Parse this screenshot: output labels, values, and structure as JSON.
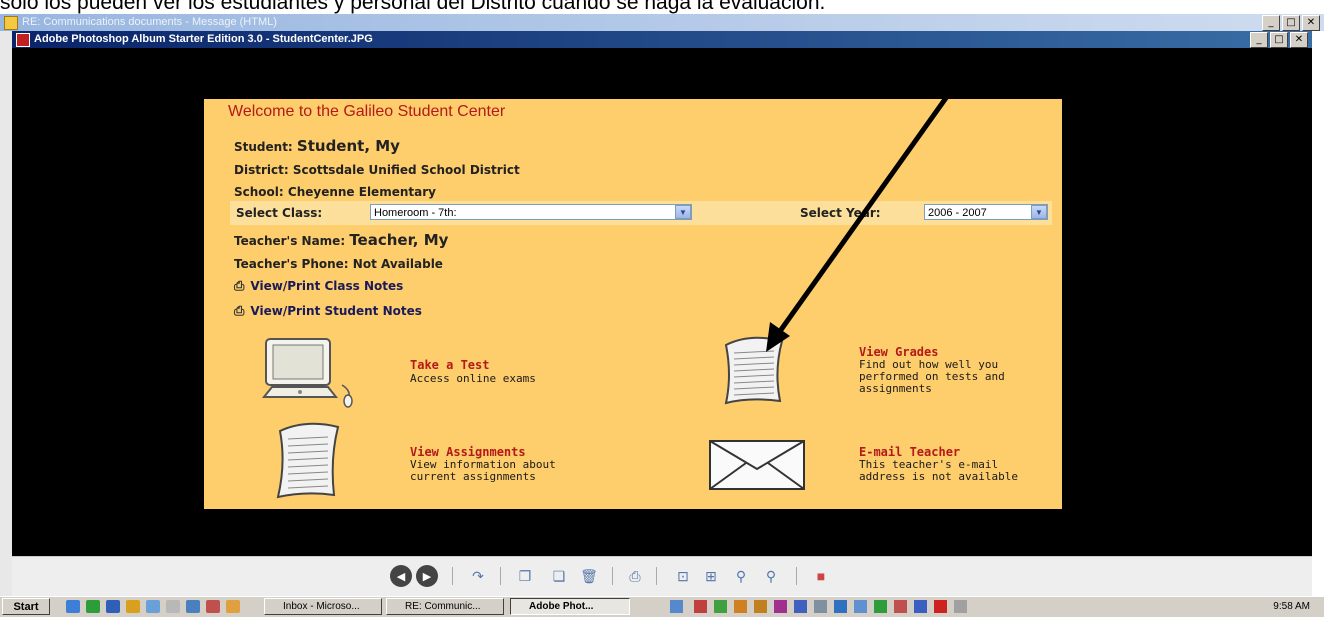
{
  "caption": "solo los pueden ver los estudiantes y personal del Distrito cuando se haga la evaluacion.",
  "outer_window": {
    "title": "RE: Communications documents - Message (HTML)"
  },
  "app_window": {
    "title": "Adobe Photoshop Album Starter Edition 3.0 - StudentCenter.JPG"
  },
  "window_buttons": {
    "minimize": "_",
    "maximize": "□",
    "close": "✕"
  },
  "student_center": {
    "welcome": "Welcome to the Galileo Student Center",
    "student_label": "Student:",
    "student_name": "Student, My",
    "district_label": "District:",
    "district_value": "Scottsdale Unified School District",
    "school_label": "School:",
    "school_value": "Cheyenne Elementary",
    "select_class_label": "Select Class:",
    "select_class_value": "Homeroom - 7th:",
    "select_year_label": "Select Year:",
    "select_year_value": "2006 - 2007",
    "teacher_label": "Teacher's Name:",
    "teacher_name": "Teacher, My",
    "phone_label": "Teacher's Phone:",
    "phone_value": "Not Available",
    "class_notes_link": "View/Print Class Notes",
    "student_notes_link": "View/Print Student Notes",
    "tiles": {
      "take_test": {
        "title": "Take a Test",
        "desc": "Access online exams"
      },
      "view_grades": {
        "title": "View Grades",
        "desc1": "Find out how well you",
        "desc2": "performed on tests and",
        "desc3": "assignments"
      },
      "view_assignments": {
        "title": "View Assignments",
        "desc1": "View information about",
        "desc2": "current assignments"
      },
      "email_teacher": {
        "title": "E-mail Teacher",
        "desc1": "This teacher's e-mail",
        "desc2": "address is not available"
      }
    }
  },
  "taskbar": {
    "start": "Start",
    "tasks": [
      "Inbox - Microso...",
      "RE: Communic...",
      "Adobe Phot..."
    ],
    "clock": "9:58 AM"
  },
  "colors": {
    "panel": "#fecd6c",
    "accent_red": "#b41a1a",
    "viewer_bg": "#000000",
    "titlebar": "#0a246a"
  }
}
